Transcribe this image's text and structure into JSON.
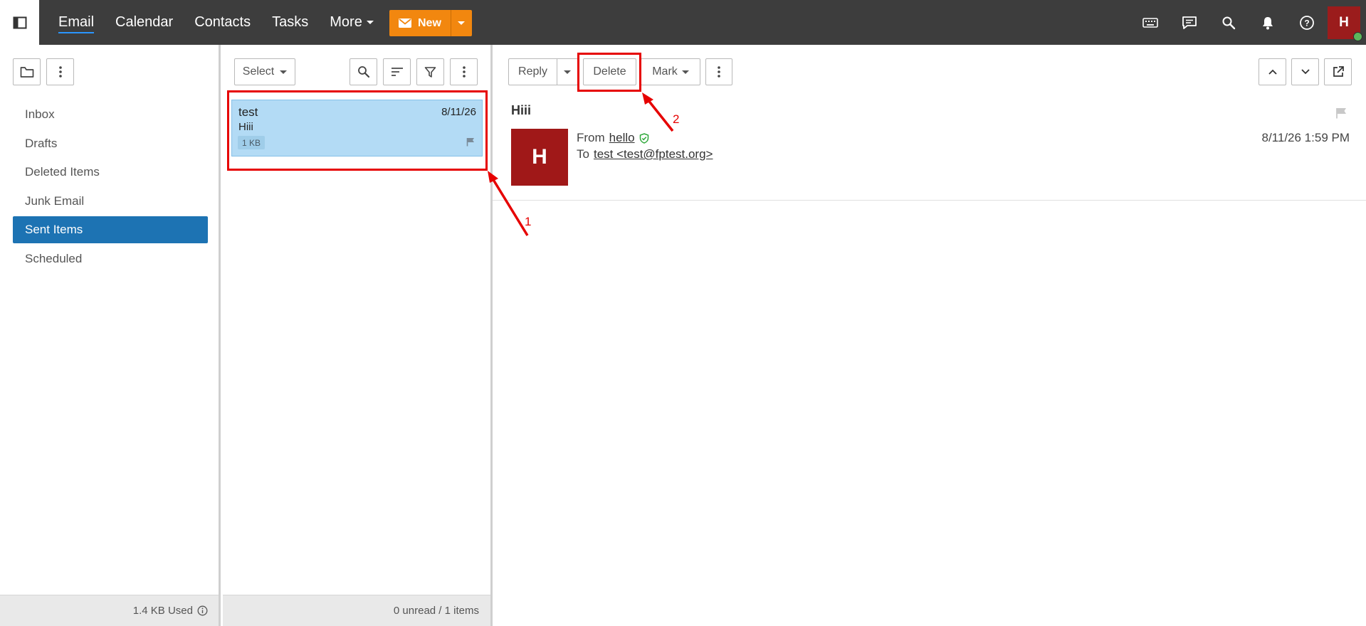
{
  "topbar": {
    "nav": [
      {
        "label": "Email",
        "active": true
      },
      {
        "label": "Calendar"
      },
      {
        "label": "Contacts"
      },
      {
        "label": "Tasks"
      },
      {
        "label": "More"
      }
    ],
    "new_label": "New",
    "avatar_initial": "H",
    "icons": [
      "keyboard-icon",
      "chat-icon",
      "search-icon",
      "bell-icon",
      "help-icon"
    ],
    "accent_color": "#f2870f",
    "bar_color": "#3d3d3d"
  },
  "sidebar": {
    "folders": [
      {
        "label": "Inbox"
      },
      {
        "label": "Drafts"
      },
      {
        "label": "Deleted Items"
      },
      {
        "label": "Junk Email"
      },
      {
        "label": "Sent Items",
        "selected": true
      },
      {
        "label": "Scheduled"
      }
    ],
    "storage_used": "1.4 KB Used",
    "selected_color": "#1d73b3"
  },
  "message_list": {
    "select_label": "Select",
    "items": [
      {
        "sender": "test",
        "date": "8/11/26",
        "subject": "Hiii",
        "size": "1 KB",
        "selected": true
      }
    ],
    "footer": "0 unread / 1 items"
  },
  "reading_pane": {
    "toolbar": {
      "reply_label": "Reply",
      "delete_label": "Delete",
      "mark_label": "Mark"
    },
    "subject": "Hiii",
    "sender_initial": "H",
    "from_label": "From",
    "from_name": "hello",
    "to_label": "To",
    "to_address": "test <test@fptest.org>",
    "timestamp": "8/11/26 1:59 PM"
  },
  "annotations": {
    "labels": [
      "1",
      "2"
    ],
    "color": "#e60000"
  }
}
